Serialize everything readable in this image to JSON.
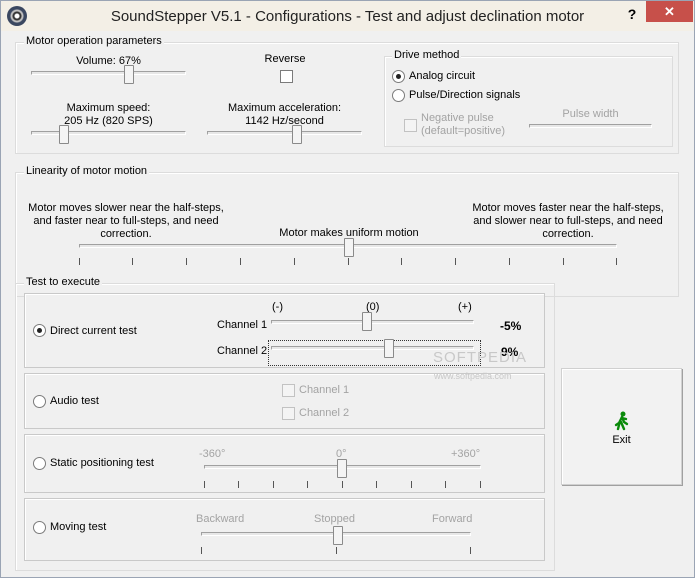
{
  "window": {
    "title": "SoundStepper V5.1 - Configurations - Test and adjust declination motor",
    "help_glyph": "?",
    "close_glyph": "✕"
  },
  "motor_params": {
    "legend": "Motor operation parameters",
    "volume_label": "Volume: 67%",
    "volume_level": 0.67,
    "reverse_label": "Reverse",
    "reverse_checked": false,
    "max_speed_label": "Maximum speed:",
    "max_speed_value": "205 Hz (820 SPS)",
    "max_accel_label": "Maximum acceleration:",
    "max_accel_value": "1142 Hz/second"
  },
  "drive_method": {
    "legend": "Drive method",
    "analog_label": "Analog circuit",
    "pulse_label": "Pulse/Direction signals",
    "selected": "Analog circuit",
    "negative_pulse_line1": "Negative pulse",
    "negative_pulse_line2": "(default=positive)",
    "pulse_width_label": "Pulse width"
  },
  "linearity": {
    "legend": "Linearity of motor motion",
    "left_line1": "Motor moves slower near the half-steps,",
    "left_line2": "and faster near to full-steps, and need",
    "left_line3": "correction.",
    "center_label": "Motor makes uniform motion",
    "right_line1": "Motor moves faster near the half-steps,",
    "right_line2": "and slower near to full-steps, and need",
    "right_line3": "correction."
  },
  "tests": {
    "legend": "Test to execute",
    "dc_label": "Direct current test",
    "audio_label": "Audio test",
    "static_label": "Static positioning test",
    "moving_label": "Moving test",
    "selected": "Direct current test",
    "minus_label": "(-)",
    "zero_label": "(0)",
    "plus_label": "(+)",
    "channel1_label": "Channel 1",
    "channel2_label": "Channel 2",
    "channel1_value": "-5%",
    "channel2_value": "9%",
    "audio_ch1_label": "Channel 1",
    "audio_ch2_label": "Channel 2",
    "deg_minus": "-360°",
    "deg_zero": "0°",
    "deg_plus": "+360°",
    "backward_label": "Backward",
    "stopped_label": "Stopped",
    "forward_label": "Forward"
  },
  "exit": {
    "label": "Exit",
    "icon": "running-man-icon"
  },
  "watermark": {
    "text": "SOFTPEDIA",
    "sub": "www.softpedia.com"
  }
}
